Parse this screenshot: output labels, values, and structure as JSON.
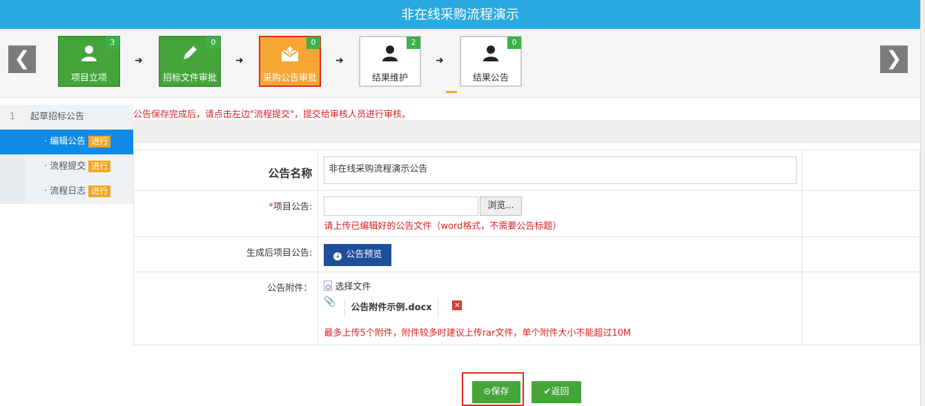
{
  "title": "非在线采购流程演示",
  "nav": {
    "prev_glyph": "❮",
    "next_glyph": "❯"
  },
  "steps": [
    {
      "label": "项目立项",
      "badge": "3",
      "state": "done",
      "icon": "user-icon"
    },
    {
      "label": "招标文件审批",
      "badge": "0",
      "state": "done",
      "icon": "pencil-icon"
    },
    {
      "label": "采购公告审批",
      "badge": "0",
      "state": "current",
      "icon": "upload-envelope-icon"
    },
    {
      "label": "结果维护",
      "badge": "2",
      "state": "pending",
      "icon": "user-icon"
    },
    {
      "label": "结果公告",
      "badge": "0",
      "state": "pending",
      "icon": "user-icon"
    }
  ],
  "sidebar": {
    "section_number": "1",
    "section_title": "起草招标公告",
    "items": [
      {
        "label": "· 编辑公告",
        "tag": "进行",
        "active": true
      },
      {
        "label": "· 流程提交",
        "tag": "进行",
        "active": false
      },
      {
        "label": "· 流程日志",
        "tag": "进行",
        "active": false
      }
    ]
  },
  "notice": "公告保存完成后，请点击左边\"流程提交\"，提交给审核人员进行审核。",
  "form": {
    "name_label": "公告名称",
    "name_value": "非在线采购流程演示公告",
    "project_notice_required": "*",
    "project_notice_label": "项目公告:",
    "browse_label": "浏览...",
    "upload_hint": "请上传已编辑好的公告文件（word格式，不需要公告标题）",
    "generated_label": "生成后项目公告:",
    "preview_label": "公告预览",
    "attachment_label": "公告附件：",
    "select_file_label": "选择文件",
    "attachment_name": "公告附件示例.docx",
    "attachment_hint": "最多上传5个附件，附件较多时建议上传rar文件，单个附件大小不能超过10M"
  },
  "actions": {
    "save_label": "保存",
    "back_label": "返回"
  },
  "colors": {
    "header": "#2ba9e1",
    "green": "#44a53a",
    "orange": "#f7a535",
    "active_blue": "#108be6",
    "tag": "#f5a623",
    "red_text": "#e02020",
    "preview": "#1f4e9b"
  }
}
